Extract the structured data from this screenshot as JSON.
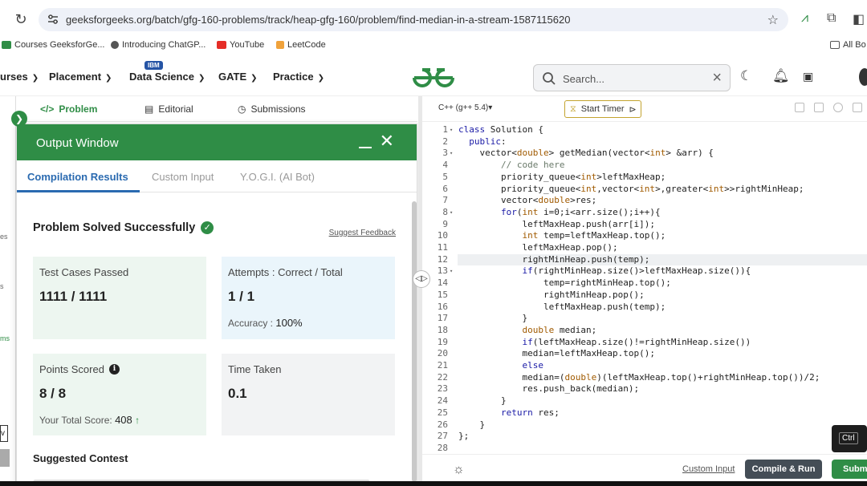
{
  "browser": {
    "url": "geeksforgeeks.org/batch/gfg-160-problems/track/heap-gfg-160/problem/find-median-in-a-stream-1587115620",
    "bookmarks": [
      "Courses GeeksforGe...",
      "Introducing ChatGP...",
      "YouTube",
      "LeetCode"
    ],
    "all_bookmarks": "All Bo"
  },
  "nav": {
    "menus": [
      "urses",
      "Placement",
      "Data Science",
      "GATE",
      "Practice"
    ],
    "ibm_badge": "IBM",
    "search_placeholder": "Search..."
  },
  "left_strip": {
    "labels": [
      "es",
      "s",
      "ms",
      "v"
    ]
  },
  "problem_tabs": [
    "Problem",
    "Editorial",
    "Submissions"
  ],
  "output_window": {
    "title": "Output Window",
    "tabs": [
      "Compilation Results",
      "Custom Input",
      "Y.O.G.I. (AI Bot)"
    ],
    "status": "Problem Solved Successfully",
    "suggest_feedback": "Suggest Feedback",
    "cards": {
      "test_cases": {
        "label": "Test Cases Passed",
        "value": "1111 / 1111"
      },
      "attempts": {
        "label": "Attempts : Correct / Total",
        "value": "1 / 1",
        "sub_label": "Accuracy :",
        "sub_value": "100%"
      },
      "points": {
        "label": "Points Scored",
        "value": "8 / 8",
        "sub_label": "Your Total Score:",
        "sub_value": "408"
      },
      "time": {
        "label": "Time Taken",
        "value": "0.1"
      }
    },
    "suggested_contest": "Suggested Contest"
  },
  "editor": {
    "language": "C++ (g++ 5.4)",
    "timer_label": "Start Timer",
    "highlight_line": 12,
    "lines": [
      "class Solution {",
      "  public:",
      "    vector<double> getMedian(vector<int> &arr) {",
      "        // code here",
      "        priority_queue<int>leftMaxHeap;",
      "        priority_queue<int,vector<int>,greater<int>>rightMinHeap;",
      "        vector<double>res;",
      "        for(int i=0;i<arr.size();i++){",
      "            leftMaxHeap.push(arr[i]);",
      "            int temp=leftMaxHeap.top();",
      "            leftMaxHeap.pop();",
      "            rightMinHeap.push(temp);",
      "            if(rightMinHeap.size()>leftMaxHeap.size()){",
      "                temp=rightMinHeap.top();",
      "                rightMinHeap.pop();",
      "                leftMaxHeap.push(temp);",
      "            }",
      "            double median;",
      "            if(leftMaxHeap.size()!=rightMinHeap.size())",
      "            median=leftMaxHeap.top();",
      "            else",
      "            median=(double)(leftMaxHeap.top()+rightMinHeap.top())/2;",
      "            res.push_back(median);",
      "        }",
      "        return res;",
      "    }",
      "};",
      ""
    ],
    "fold_lines": [
      1,
      3,
      8,
      13
    ],
    "custom_input": "Custom Input",
    "compile_run": "Compile & Run",
    "submit": "Submit",
    "kbd_hint": "Ctrl"
  }
}
